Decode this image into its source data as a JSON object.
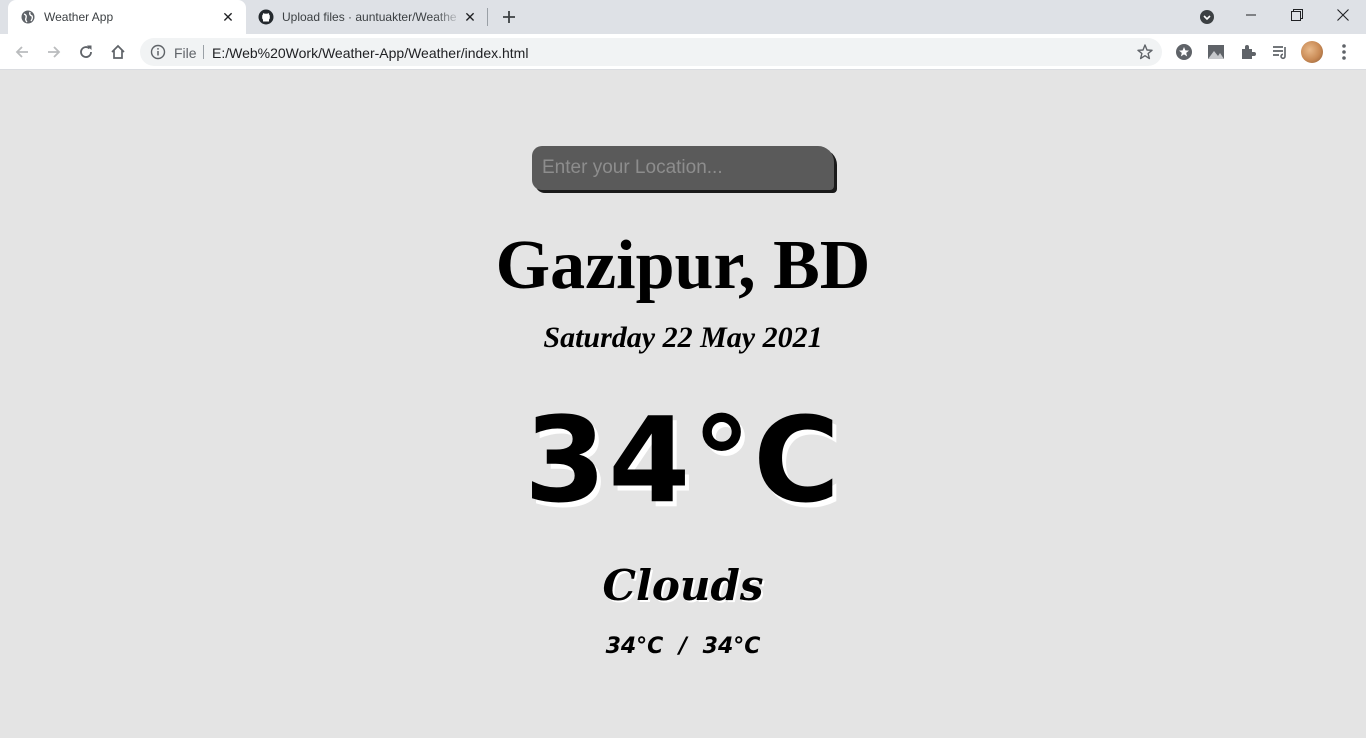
{
  "browser": {
    "tabs": [
      {
        "title": "Weather App",
        "favicon": "globe-icon",
        "active": true
      },
      {
        "title": "Upload files · auntuakter/Weathe",
        "favicon": "github-icon",
        "active": false
      }
    ],
    "address": {
      "scheme": "File",
      "url": "E:/Web%20Work/Weather-App/Weather/index.html"
    }
  },
  "search": {
    "placeholder": "Enter your Location...",
    "value": ""
  },
  "weather": {
    "city": "Gazipur, BD",
    "date": "Saturday 22 May 2021",
    "temperature": "34°C",
    "condition": "Clouds",
    "min_max": "34°C / 34°C"
  }
}
